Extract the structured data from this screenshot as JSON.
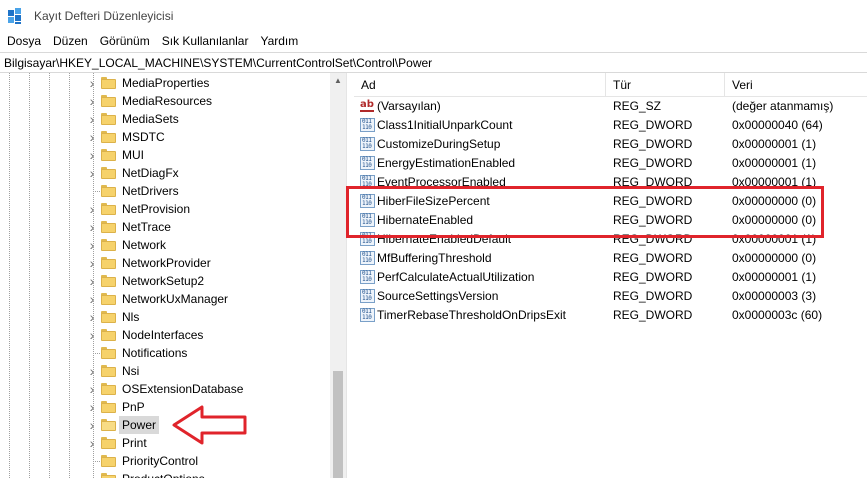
{
  "window": {
    "title": "Kayıt Defteri Düzenleyicisi",
    "app_icon": "registry-icon"
  },
  "menu": [
    "Dosya",
    "Düzen",
    "Görünüm",
    "Sık Kullanılanlar",
    "Yardım"
  ],
  "address": "Bilgisayar\\HKEY_LOCAL_MACHINE\\SYSTEM\\CurrentControlSet\\Control\\Power",
  "tree": {
    "items": [
      {
        "label": "MediaProperties",
        "expandable": true
      },
      {
        "label": "MediaResources",
        "expandable": true
      },
      {
        "label": "MediaSets",
        "expandable": true
      },
      {
        "label": "MSDTC",
        "expandable": true
      },
      {
        "label": "MUI",
        "expandable": true
      },
      {
        "label": "NetDiagFx",
        "expandable": true
      },
      {
        "label": "NetDrivers",
        "expandable": false
      },
      {
        "label": "NetProvision",
        "expandable": true
      },
      {
        "label": "NetTrace",
        "expandable": true
      },
      {
        "label": "Network",
        "expandable": true
      },
      {
        "label": "NetworkProvider",
        "expandable": true
      },
      {
        "label": "NetworkSetup2",
        "expandable": true
      },
      {
        "label": "NetworkUxManager",
        "expandable": true
      },
      {
        "label": "Nls",
        "expandable": true
      },
      {
        "label": "NodeInterfaces",
        "expandable": true
      },
      {
        "label": "Notifications",
        "expandable": false
      },
      {
        "label": "Nsi",
        "expandable": true
      },
      {
        "label": "OSExtensionDatabase",
        "expandable": true
      },
      {
        "label": "PnP",
        "expandable": true
      },
      {
        "label": "Power",
        "expandable": true,
        "selected": true
      },
      {
        "label": "Print",
        "expandable": true
      },
      {
        "label": "PriorityControl",
        "expandable": false
      },
      {
        "label": "ProductOptions",
        "expandable": false
      }
    ]
  },
  "list": {
    "columns": [
      "Ad",
      "Tür",
      "Veri"
    ],
    "rows": [
      {
        "icon": "string",
        "name": "(Varsayılan)",
        "type": "REG_SZ",
        "data": "(değer atanmamış)"
      },
      {
        "icon": "binary",
        "name": "Class1InitialUnparkCount",
        "type": "REG_DWORD",
        "data": "0x00000040 (64)"
      },
      {
        "icon": "binary",
        "name": "CustomizeDuringSetup",
        "type": "REG_DWORD",
        "data": "0x00000001 (1)"
      },
      {
        "icon": "binary",
        "name": "EnergyEstimationEnabled",
        "type": "REG_DWORD",
        "data": "0x00000001 (1)"
      },
      {
        "icon": "binary",
        "name": "EventProcessorEnabled",
        "type": "REG_DWORD",
        "data": "0x00000001 (1)"
      },
      {
        "icon": "binary",
        "name": "HiberFileSizePercent",
        "type": "REG_DWORD",
        "data": "0x00000000 (0)"
      },
      {
        "icon": "binary",
        "name": "HibernateEnabled",
        "type": "REG_DWORD",
        "data": "0x00000000 (0)"
      },
      {
        "icon": "binary",
        "name": "HibernateEnabledDefault",
        "type": "REG_DWORD",
        "data": "0x00000001 (1)"
      },
      {
        "icon": "binary",
        "name": "MfBufferingThreshold",
        "type": "REG_DWORD",
        "data": "0x00000000 (0)"
      },
      {
        "icon": "binary",
        "name": "PerfCalculateActualUtilization",
        "type": "REG_DWORD",
        "data": "0x00000001 (1)"
      },
      {
        "icon": "binary",
        "name": "SourceSettingsVersion",
        "type": "REG_DWORD",
        "data": "0x00000003 (3)"
      },
      {
        "icon": "binary",
        "name": "TimerRebaseThresholdOnDripsExit",
        "type": "REG_DWORD",
        "data": "0x0000003c (60)"
      }
    ]
  },
  "annotation": {
    "highlight_color": "#e0242b",
    "arrow_color": "#e0242b"
  },
  "binary_icon_text": "011\n110"
}
